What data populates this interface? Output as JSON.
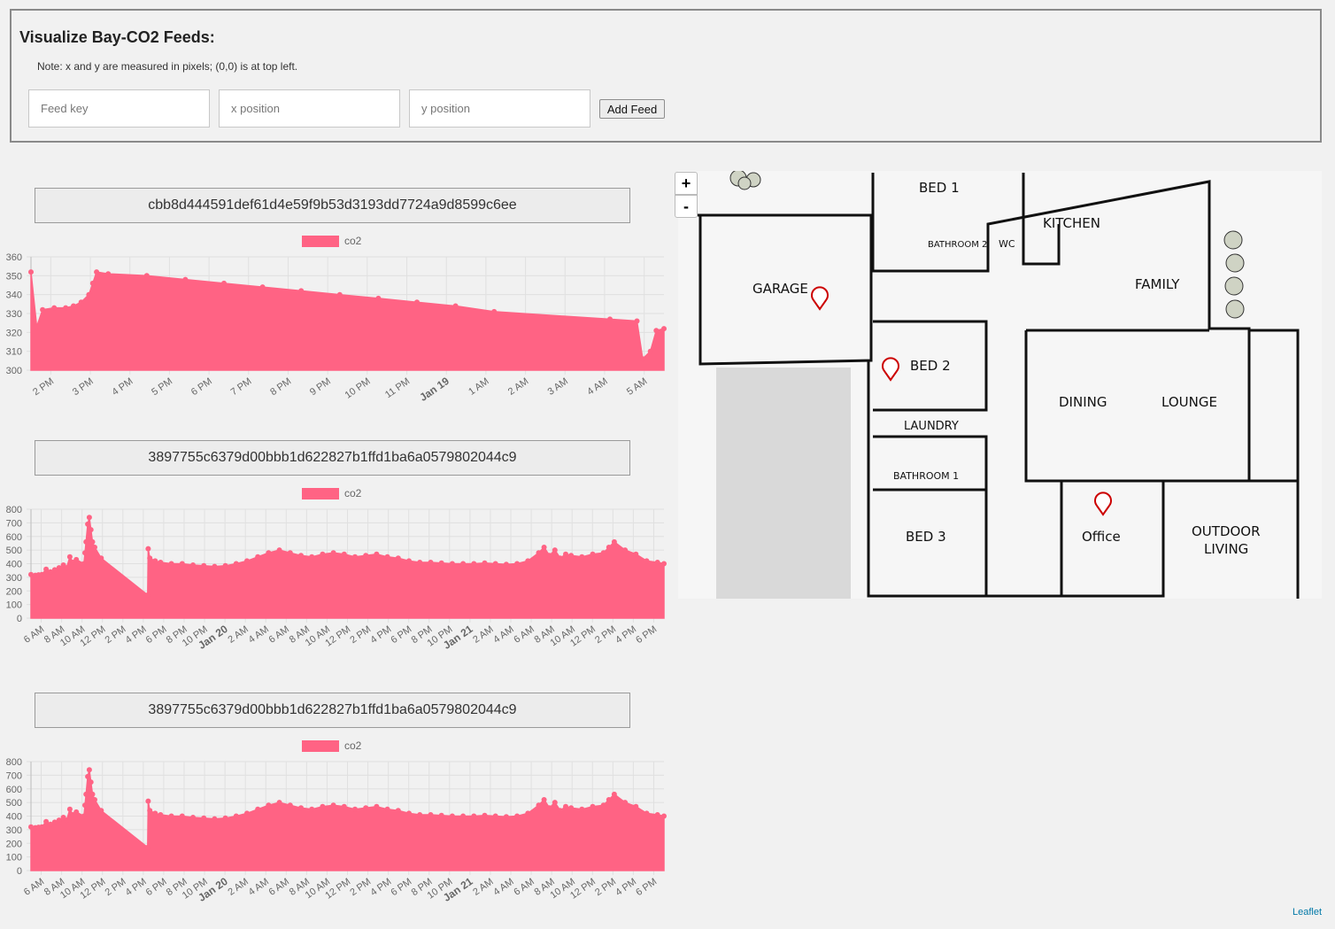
{
  "form": {
    "title": "Visualize Bay-CO2 Feeds:",
    "note": "Note: x and y are measured in pixels; (0,0) is at top left.",
    "feed_key_placeholder": "Feed key",
    "x_placeholder": "x position",
    "y_placeholder": "y position",
    "add_button": "Add Feed"
  },
  "feeds": [
    {
      "key": "cbb8d444591def61d4e59f9b53d3193dd7724a9d8599c6ee"
    },
    {
      "key": "3897755c6379d00bbb1d622827b1ffd1ba6a0579802044c9"
    },
    {
      "key": "3897755c6379d00bbb1d622827b1ffd1ba6a0579802044c9"
    }
  ],
  "chart_data": [
    {
      "type": "area",
      "series": [
        {
          "name": "co2",
          "color": "#ff6384",
          "values": [
            352,
            323,
            332,
            333,
            333,
            334,
            336,
            340,
            346,
            352,
            351,
            350,
            348,
            346,
            344,
            342,
            340,
            338,
            336,
            334,
            331,
            327,
            326,
            306,
            310,
            321,
            322
          ]
        }
      ],
      "x": [
        0,
        0.15,
        0.3,
        0.6,
        0.9,
        1.1,
        1.3,
        1.5,
        1.6,
        1.7,
        2,
        3,
        4,
        5,
        6,
        7,
        8,
        9,
        10,
        11,
        12,
        15,
        15.7,
        15.85,
        16.05,
        16.2,
        16.4
      ],
      "ylim": [
        300,
        360
      ],
      "yticks": [
        "360",
        "350",
        "340",
        "330",
        "320",
        "310",
        "300"
      ],
      "xticks": [
        "2 PM",
        "3 PM",
        "4 PM",
        "5 PM",
        "6 PM",
        "7 PM",
        "8 PM",
        "9 PM",
        "10 PM",
        "11 PM",
        "Jan 19",
        "1 AM",
        "2 AM",
        "3 AM",
        "4 AM",
        "5 AM"
      ],
      "legend": "top",
      "grid": true
    },
    {
      "type": "area",
      "series": [
        {
          "name": "co2",
          "color": "#ff6384",
          "values": [
            320,
            300,
            315,
            318,
            320,
            360,
            340,
            355,
            370,
            390,
            370,
            450,
            410,
            430,
            400,
            480,
            560,
            690,
            740,
            650,
            560,
            520,
            440,
            170,
            510,
            440,
            420,
            410,
            400,
            400,
            390,
            385,
            380,
            385,
            400,
            420,
            450,
            480,
            500,
            480,
            460,
            450,
            470,
            480,
            470,
            450,
            460,
            470,
            450,
            440,
            420,
            410,
            410,
            405,
            400,
            400,
            400,
            405,
            400,
            395,
            400,
            420,
            480,
            520,
            460,
            500,
            440,
            470,
            460,
            450,
            470,
            480,
            520,
            560,
            500,
            470,
            420,
            410,
            400
          ]
        }
      ],
      "x": [
        0,
        0.2,
        0.4,
        0.7,
        1,
        1.4,
        1.8,
        2.2,
        2.6,
        3,
        3.3,
        3.6,
        3.9,
        4.2,
        4.9,
        5,
        5.1,
        5.25,
        5.4,
        5.55,
        5.7,
        5.9,
        6.5,
        10.8,
        10.85,
        11,
        11.5,
        12,
        13,
        14,
        15,
        16,
        17,
        18,
        19,
        20,
        21,
        22,
        23,
        24,
        25,
        26,
        27,
        28,
        29,
        30,
        31,
        32,
        33,
        34,
        35,
        36,
        37,
        38,
        39,
        40,
        41,
        42,
        43,
        44,
        45,
        46,
        47,
        47.5,
        48,
        48.5,
        49,
        49.5,
        50,
        51,
        52,
        53,
        53.5,
        54,
        55,
        56,
        57,
        58,
        58.6
      ],
      "ylim": [
        0,
        800
      ],
      "yticks": [
        "800",
        "700",
        "600",
        "500",
        "400",
        "300",
        "200",
        "100",
        "0"
      ],
      "xticks": [
        "6 AM",
        "8 AM",
        "10 AM",
        "12 PM",
        "2 PM",
        "4 PM",
        "6 PM",
        "8 PM",
        "10 PM",
        "Jan 20",
        "2 AM",
        "4 AM",
        "6 AM",
        "8 AM",
        "10 AM",
        "12 PM",
        "2 PM",
        "4 PM",
        "6 PM",
        "8 PM",
        "10 PM",
        "Jan 21",
        "2 AM",
        "4 AM",
        "6 AM",
        "8 AM",
        "10 AM",
        "12 PM",
        "2 PM",
        "4 PM",
        "6 PM"
      ],
      "legend": "top",
      "grid": true
    },
    {
      "type": "area",
      "series": [
        {
          "name": "co2",
          "color": "#ff6384",
          "values": [
            320,
            300,
            315,
            318,
            320,
            360,
            340,
            355,
            370,
            390,
            370,
            450,
            410,
            430,
            400,
            480,
            560,
            690,
            740,
            650,
            560,
            520,
            440,
            170,
            510,
            440,
            420,
            410,
            400,
            400,
            390,
            385,
            380,
            385,
            400,
            420,
            450,
            480,
            500,
            480,
            460,
            450,
            470,
            480,
            470,
            450,
            460,
            470,
            450,
            440,
            420,
            410,
            410,
            405,
            400,
            400,
            400,
            405,
            400,
            395,
            400,
            420,
            480,
            520,
            460,
            500,
            440,
            470,
            460,
            450,
            470,
            480,
            520,
            560,
            500,
            470,
            420,
            410,
            400
          ]
        }
      ],
      "x": [
        0,
        0.2,
        0.4,
        0.7,
        1,
        1.4,
        1.8,
        2.2,
        2.6,
        3,
        3.3,
        3.6,
        3.9,
        4.2,
        4.9,
        5,
        5.1,
        5.25,
        5.4,
        5.55,
        5.7,
        5.9,
        6.5,
        10.8,
        10.85,
        11,
        11.5,
        12,
        13,
        14,
        15,
        16,
        17,
        18,
        19,
        20,
        21,
        22,
        23,
        24,
        25,
        26,
        27,
        28,
        29,
        30,
        31,
        32,
        33,
        34,
        35,
        36,
        37,
        38,
        39,
        40,
        41,
        42,
        43,
        44,
        45,
        46,
        47,
        47.5,
        48,
        48.5,
        49,
        49.5,
        50,
        51,
        52,
        53,
        53.5,
        54,
        55,
        56,
        57,
        58,
        58.6
      ],
      "ylim": [
        0,
        800
      ],
      "yticks": [
        "800",
        "700",
        "600",
        "500",
        "400",
        "300",
        "200",
        "100",
        "0"
      ],
      "xticks": [
        "6 AM",
        "8 AM",
        "10 AM",
        "12 PM",
        "2 PM",
        "4 PM",
        "6 PM",
        "8 PM",
        "10 PM",
        "Jan 20",
        "2 AM",
        "4 AM",
        "6 AM",
        "8 AM",
        "10 AM",
        "12 PM",
        "2 PM",
        "4 PM",
        "6 PM",
        "8 PM",
        "10 PM",
        "Jan 21",
        "2 AM",
        "4 AM",
        "6 AM",
        "8 AM",
        "10 AM",
        "12 PM",
        "2 PM",
        "4 PM",
        "6 PM"
      ],
      "legend": "top",
      "grid": true
    }
  ],
  "map": {
    "zoom_in": "+",
    "zoom_out": "-",
    "attribution": "Leaflet",
    "rooms": [
      "BED 1",
      "BATHROOM 2",
      "WC",
      "KITCHEN",
      "GARAGE",
      "FAMILY",
      "BED 2",
      "DINING",
      "LOUNGE",
      "LAUNDRY",
      "BATHROOM 1",
      "BED 3",
      "Office",
      "OUTDOOR",
      "LIVING"
    ],
    "marker_color": "#cc0000"
  }
}
